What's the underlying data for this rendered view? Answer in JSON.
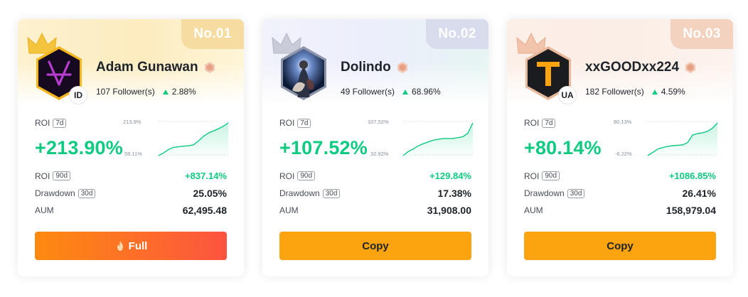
{
  "colors": {
    "green": "#0ecb81",
    "copy_button": "#fca310",
    "full_button_start": "#fd8a10",
    "full_button_end": "#fc5440"
  },
  "cards": [
    {
      "rank": "No.01",
      "name": "Adam Gunawan",
      "country": "ID",
      "followers": "107 Follower(s)",
      "follower_change": "2.88%",
      "roi_label": "ROI",
      "roi_period": "7d",
      "roi_7d": "+213.90%",
      "chart_max": "213.9%",
      "chart_min": "59.11%",
      "stats": [
        {
          "label": "ROI",
          "tag": "90d",
          "value": "+837.14%"
        },
        {
          "label": "Drawdown",
          "tag": "30d",
          "value": "25.05%"
        },
        {
          "label": "AUM",
          "tag": "",
          "value": "62,495.48"
        }
      ],
      "button": "Full",
      "button_icon": "fire-icon",
      "avatar": "vbank-logo"
    },
    {
      "rank": "No.02",
      "name": "Dolindo",
      "country": "",
      "followers": "49 Follower(s)",
      "follower_change": "68.96%",
      "roi_label": "ROI",
      "roi_period": "7d",
      "roi_7d": "+107.52%",
      "chart_max": "107.52%",
      "chart_min": "32.92%",
      "stats": [
        {
          "label": "ROI",
          "tag": "90d",
          "value": "+129.84%"
        },
        {
          "label": "Drawdown",
          "tag": "30d",
          "value": "17.38%"
        },
        {
          "label": "AUM",
          "tag": "",
          "value": "31,908.00"
        }
      ],
      "button": "Copy",
      "avatar": "religious-painting"
    },
    {
      "rank": "No.03",
      "name": "xxGOODxx224",
      "country": "UA",
      "followers": "182 Follower(s)",
      "follower_change": "4.59%",
      "roi_label": "ROI",
      "roi_period": "7d",
      "roi_7d": "+80.14%",
      "chart_max": "80.13%",
      "chart_min": "-6.22%",
      "stats": [
        {
          "label": "ROI",
          "tag": "90d",
          "value": "+1086.85%"
        },
        {
          "label": "Drawdown",
          "tag": "30d",
          "value": "26.41%"
        },
        {
          "label": "AUM",
          "tag": "",
          "value": "158,979.04"
        }
      ],
      "button": "Copy",
      "avatar": "tether-logo"
    }
  ],
  "chart_data": [
    {
      "type": "area",
      "x": [
        0,
        1,
        2,
        3,
        4,
        5,
        6,
        7,
        8,
        9,
        10,
        11,
        12,
        13,
        14
      ],
      "y": [
        59.11,
        72,
        88,
        98,
        101,
        104,
        106,
        110,
        128,
        150,
        166,
        176,
        186,
        198,
        213.9
      ],
      "ylim": [
        59.11,
        213.9
      ],
      "grid": false
    },
    {
      "type": "area",
      "x": [
        0,
        1,
        2,
        3,
        4,
        5,
        6,
        7,
        8,
        9,
        10,
        11,
        12,
        13,
        14
      ],
      "y": [
        32.92,
        42,
        48,
        55,
        60,
        64,
        68,
        70,
        72,
        72,
        72,
        74,
        76,
        84,
        107.52
      ],
      "ylim": [
        32.92,
        107.52
      ],
      "grid": false
    },
    {
      "type": "area",
      "x": [
        0,
        1,
        2,
        3,
        4,
        5,
        6,
        7,
        8,
        9,
        10,
        11,
        12,
        13,
        14
      ],
      "y": [
        -6.22,
        2,
        11,
        15,
        18,
        20,
        21,
        22,
        28,
        48,
        52,
        54,
        58,
        66,
        80.13
      ],
      "ylim": [
        -6.22,
        80.13
      ],
      "grid": false
    }
  ]
}
